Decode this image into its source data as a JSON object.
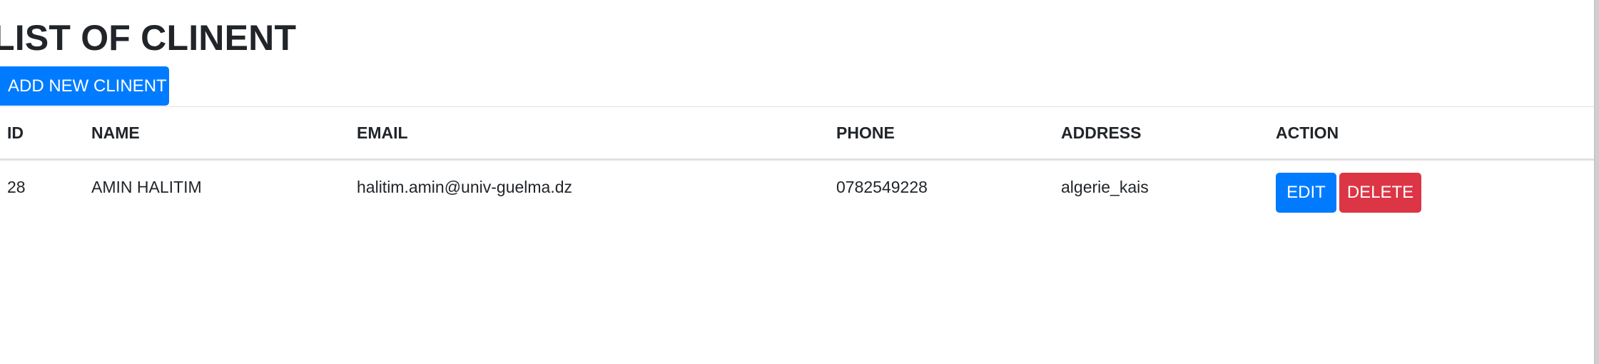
{
  "page": {
    "title": "LIST OF CLINENT",
    "add_button_label": "ADD NEW CLINENT"
  },
  "table": {
    "columns": [
      "ID",
      "NAME",
      "EMAIL",
      "PHONE",
      "ADDRESS",
      "ACTION"
    ],
    "rows": [
      {
        "id": "28",
        "name": "AMIN HALITIM",
        "email": "halitim.amin@univ-guelma.dz",
        "phone": "0782549228",
        "address": "algerie_kais",
        "edit_label": "EDIT",
        "delete_label": "DELETE"
      }
    ]
  },
  "colors": {
    "primary": "#007bff",
    "danger": "#dc3545",
    "text": "#212529",
    "border": "#dee2e6"
  }
}
